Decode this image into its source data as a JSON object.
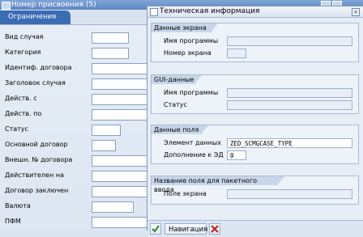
{
  "background_window": {
    "title": "Номер присвоения (5)",
    "tab_label": "Ограничения",
    "fields": [
      {
        "label": "Вид случая"
      },
      {
        "label": "Категория"
      },
      {
        "label": "Идентиф. договора"
      },
      {
        "label": "Заголовок случая"
      },
      {
        "label": "Действ. с"
      },
      {
        "label": "Действ. по"
      },
      {
        "label": "Статус"
      },
      {
        "label": "Основной договор"
      },
      {
        "label": "Внешн. № договора"
      },
      {
        "label": "Действителен на"
      },
      {
        "label": "Договор заключен"
      },
      {
        "label": "Валюта"
      },
      {
        "label": "ПФМ"
      }
    ]
  },
  "dialog": {
    "title": "Техническая информация",
    "groups": {
      "screen": {
        "header": "Данные экрана",
        "program_label": "Имя программы",
        "program_value": "",
        "screen_label": "Номер экрана",
        "screen_value": ""
      },
      "gui": {
        "header": "GUI-данные",
        "program_label": "Имя программы",
        "program_value": "",
        "status_label": "Статус",
        "status_value": ""
      },
      "field": {
        "header": "Данные поля",
        "element_label": "Элемент данных",
        "element_value": "ZED_SCMGCASE_TYPE",
        "addition_label": "Дополнение к ЭД",
        "addition_value": "0"
      },
      "batch": {
        "header": "Название поля для пакетного ввода",
        "screen_field_label": "Поле экрана",
        "screen_field_value": ""
      }
    },
    "footer": {
      "nav_label": "Навигация"
    }
  },
  "colors": {
    "title_blue": "#5e86c2",
    "tab_blue": "#3a6cb4",
    "confirm_green": "#2e8b2e",
    "cancel_red": "#c0231b"
  }
}
